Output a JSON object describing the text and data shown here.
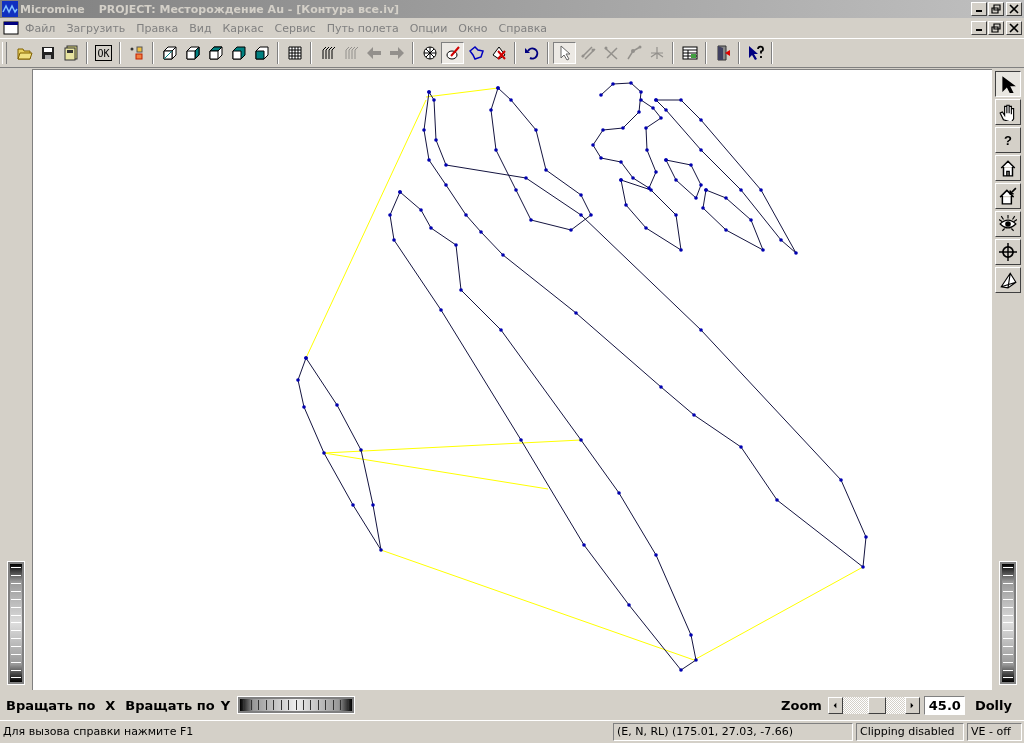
{
  "window": {
    "app_name": "Micromine",
    "title": "PROJECT: Месторождение Au - [Контура все.iv]"
  },
  "menu": [
    "Файл",
    "Загрузить",
    "Правка",
    "Вид",
    "Каркас",
    "Сервис",
    "Путь полета",
    "Опции",
    "Окно",
    "Справка"
  ],
  "toolbar": {
    "groups": [
      [
        {
          "selected": false,
          "disabled": false
        },
        {
          "selected": false,
          "disabled": false
        },
        {
          "selected": false,
          "disabled": false
        }
      ],
      [
        {
          "selected": false,
          "disabled": false,
          "label": "OK"
        }
      ],
      [
        {
          "selected": false,
          "disabled": false
        }
      ],
      [
        {
          "selected": false,
          "disabled": false
        },
        {
          "selected": false,
          "disabled": false
        },
        {
          "selected": false,
          "disabled": false
        },
        {
          "selected": false,
          "disabled": false
        },
        {
          "selected": false,
          "disabled": false
        }
      ],
      [
        {
          "selected": false,
          "disabled": false
        }
      ],
      [
        {
          "selected": false,
          "disabled": false
        },
        {
          "selected": false,
          "disabled": true
        },
        {
          "selected": false,
          "disabled": true
        },
        {
          "selected": false,
          "disabled": true
        }
      ],
      [
        {
          "selected": false,
          "disabled": false
        },
        {
          "selected": true,
          "disabled": false
        },
        {
          "selected": false,
          "disabled": false
        },
        {
          "selected": false,
          "disabled": false
        }
      ],
      [
        {
          "selected": false,
          "disabled": false
        }
      ],
      [
        {
          "selected": true,
          "disabled": false
        },
        {
          "selected": false,
          "disabled": true
        },
        {
          "selected": false,
          "disabled": true
        },
        {
          "selected": false,
          "disabled": true
        },
        {
          "selected": false,
          "disabled": true
        }
      ],
      [
        {
          "selected": false,
          "disabled": false
        }
      ],
      [
        {
          "selected": false,
          "disabled": false
        }
      ],
      [
        {
          "selected": false,
          "disabled": false
        }
      ]
    ]
  },
  "right_toolbar": [
    {
      "selected": true
    },
    {
      "selected": false
    },
    {
      "selected": false,
      "label": "?"
    },
    {
      "selected": false
    },
    {
      "selected": false
    },
    {
      "selected": false
    },
    {
      "selected": false
    },
    {
      "selected": false
    }
  ],
  "controls": {
    "rotate_x_label": "Вращать по",
    "rotate_x_axis": "X",
    "rotate_y_label": "Вращать по",
    "rotate_y_axis": "Y",
    "zoom_label": "Zoom",
    "zoom": {
      "level": 0.55
    },
    "zoom_value": "45.0",
    "dolly_label": "Dolly"
  },
  "status_bar": [
    "Для вызова справки нажмите F1",
    "(E, N, RL) (175.01, 27.03, -7.66)",
    "Clipping disabled",
    "VE - off"
  ]
}
